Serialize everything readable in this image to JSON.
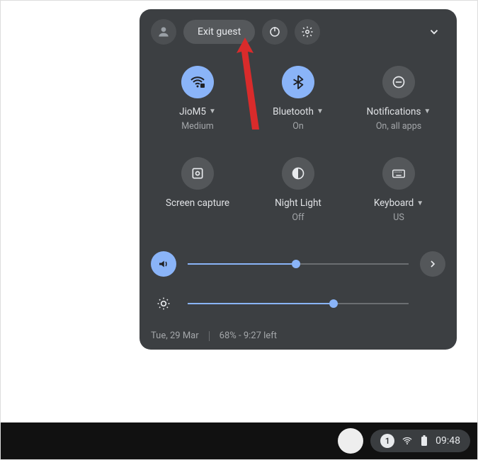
{
  "header": {
    "exit_label": "Exit guest"
  },
  "tiles": {
    "wifi": {
      "label": "JioM5",
      "sub": "Medium",
      "has_caret": true,
      "active": true
    },
    "bluetooth": {
      "label": "Bluetooth",
      "sub": "On",
      "has_caret": true,
      "active": true
    },
    "notif": {
      "label": "Notifications",
      "sub": "On, all apps",
      "has_caret": true,
      "active": false
    },
    "capture": {
      "label": "Screen capture",
      "sub": "",
      "has_caret": false,
      "active": false
    },
    "night": {
      "label": "Night Light",
      "sub": "Off",
      "has_caret": false,
      "active": false
    },
    "keyboard": {
      "label": "Keyboard",
      "sub": "US",
      "has_caret": true,
      "active": false
    }
  },
  "sliders": {
    "volume": {
      "percent": 49
    },
    "brightness": {
      "percent": 66
    }
  },
  "footer": {
    "date": "Tue, 29 Mar",
    "battery": "68% - 9:27 left"
  },
  "taskbar": {
    "notif_count": "1",
    "time": "09:48"
  }
}
